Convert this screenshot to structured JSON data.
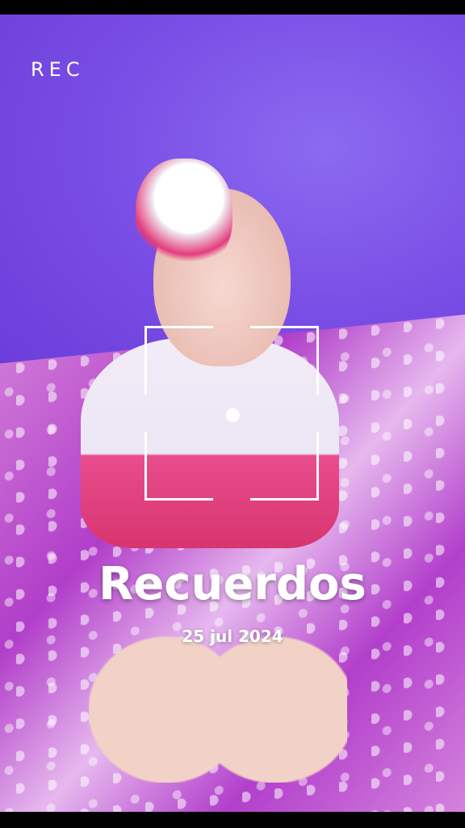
{
  "recorder": {
    "rec_label": "REC"
  },
  "overlay": {
    "title": "Recuerdos",
    "date": "25 jul 2024"
  },
  "colors": {
    "overlay_text": "#ffffff",
    "letterbox": "#000000"
  }
}
